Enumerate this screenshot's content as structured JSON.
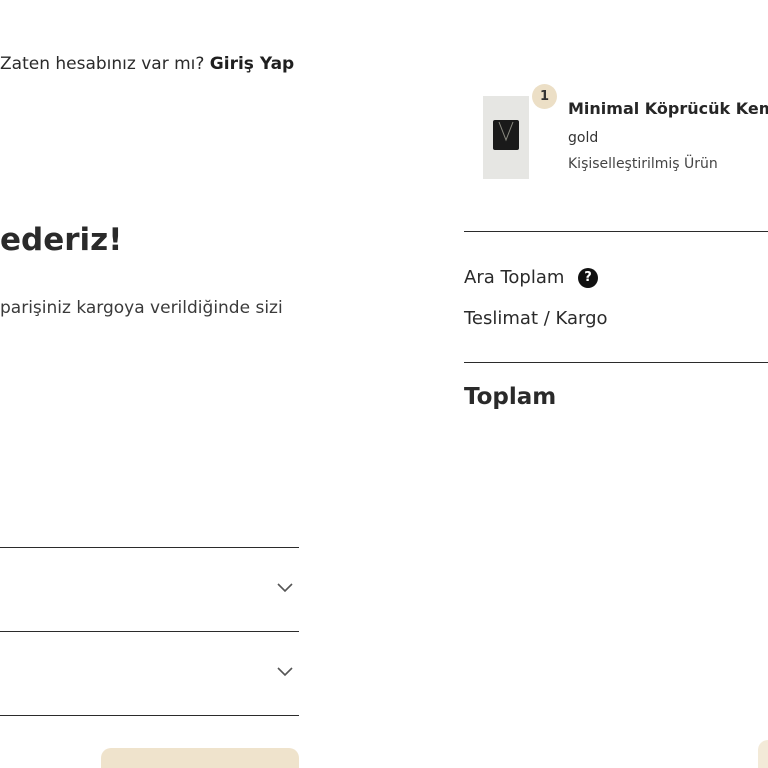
{
  "account": {
    "question": "Zaten hesabınız var mı?",
    "login_link": "Giriş Yap"
  },
  "confirmation": {
    "title": "ederiz!",
    "text": "parişiniz kargoya verildiğinde sizi"
  },
  "product": {
    "quantity": "1",
    "name": "Minimal Köprücük Kemiği",
    "variant": "gold",
    "note": "Kişiselleştirilmiş Ürün",
    "image_icon": "necklace-product-image"
  },
  "summary": {
    "subtotal_label": "Ara Toplam",
    "help_icon": "?",
    "shipping_label": "Teslimat / Kargo",
    "total_label": "Toplam"
  },
  "colors": {
    "accent_beige": "#efe3cc",
    "badge_beige": "#ecdfc6",
    "line": "#2b2b2b"
  }
}
